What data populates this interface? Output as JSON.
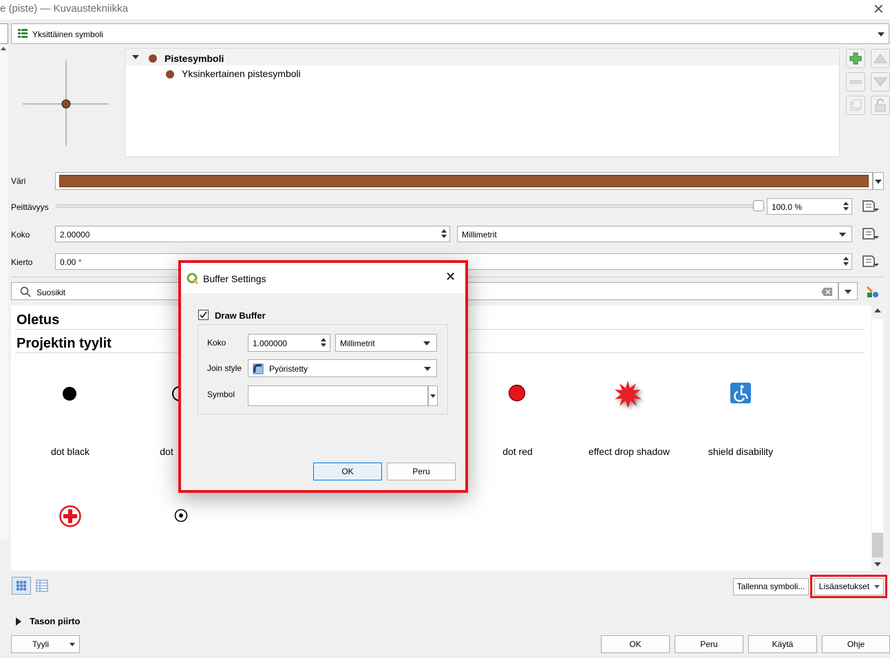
{
  "window": {
    "title": "e (piste) — Kuvaustekniikka",
    "close_symbol": "✕"
  },
  "renderer": {
    "selected": "Yksittäinen symboli"
  },
  "tree": {
    "root": "Pistesymboli",
    "child": "Yksinkertainen pistesymboli"
  },
  "colors": {
    "symbol_color": "#98542e",
    "accent_red": "#e8141e",
    "dot_brown": "#8b4a2b"
  },
  "fields": {
    "color_label": "Väri",
    "opacity_label": "Peittävyys",
    "opacity_value": "100.0 %",
    "opacity_fraction": 1.0,
    "size_label": "Koko",
    "size_value": "2.00000",
    "size_unit": "Millimetrit",
    "rotation_label": "Kierto",
    "rotation_value": "0.00 °"
  },
  "search": {
    "value": "Suosikit"
  },
  "library": {
    "group1": "Oletus",
    "group2": "Projektin tyylit",
    "symbols": [
      {
        "name": "dot  black",
        "icon": "black-dot"
      },
      {
        "name": "dot",
        "icon": "white-dot"
      },
      {
        "name": "dot red",
        "icon": "red-dot"
      },
      {
        "name": "effect drop shadow",
        "icon": "red-star-burst"
      },
      {
        "name": "shield disability",
        "icon": "accessibility-shield"
      }
    ],
    "row2_icons": [
      "red-cross-circle",
      "target-dot"
    ]
  },
  "bottom": {
    "save_symbol": "Tallenna symboli...",
    "advanced": "Lisäasetukset",
    "layer_rendering": "Tason piirto",
    "style": "Tyyli",
    "ok": "OK",
    "cancel": "Peru",
    "apply": "Käytä",
    "help": "Ohje"
  },
  "dialog": {
    "title": "Buffer Settings",
    "draw_buffer": "Draw Buffer",
    "size_label": "Koko",
    "size_value": "1.000000",
    "size_unit": "Millimetrit",
    "join_label": "Join style",
    "join_value": "Pyöristetty",
    "symbol_label": "Symbol",
    "ok": "OK",
    "cancel": "Peru"
  }
}
